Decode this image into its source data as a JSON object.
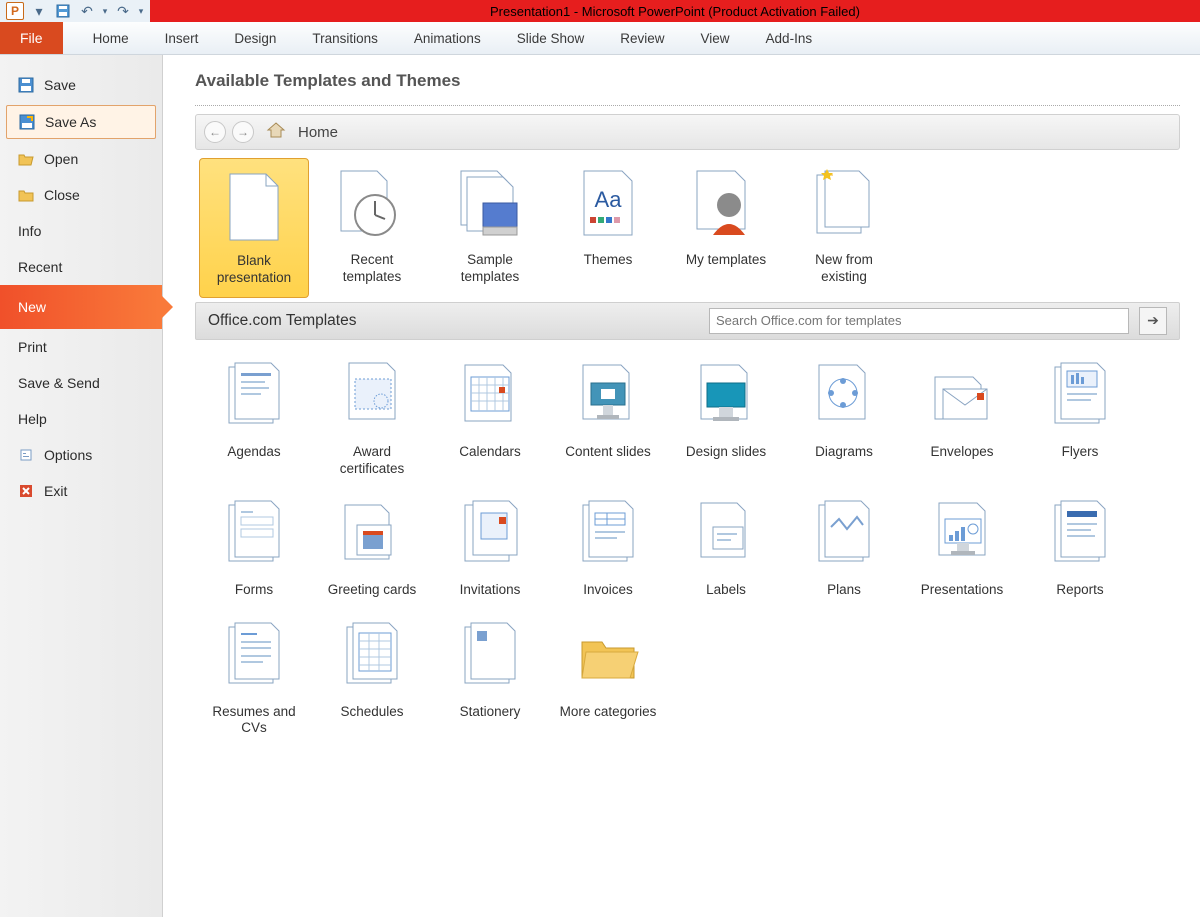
{
  "titlebar": {
    "title": "Presentation1  -  Microsoft PowerPoint (Product Activation Failed)",
    "app_letter": "P"
  },
  "ribbon": {
    "tabs": [
      "File",
      "Home",
      "Insert",
      "Design",
      "Transitions",
      "Animations",
      "Slide Show",
      "Review",
      "View",
      "Add-Ins"
    ],
    "active": "File"
  },
  "sidebar": {
    "items": [
      {
        "label": "Save",
        "icon": "save-icon"
      },
      {
        "label": "Save As",
        "icon": "save-as-icon",
        "boxed": true
      },
      {
        "label": "Open",
        "icon": "open-icon"
      },
      {
        "label": "Close",
        "icon": "close-doc-icon"
      },
      {
        "label": "Info"
      },
      {
        "label": "Recent"
      },
      {
        "label": "New",
        "active": true
      },
      {
        "label": "Print"
      },
      {
        "label": "Save & Send"
      },
      {
        "label": "Help"
      },
      {
        "label": "Options",
        "icon": "options-icon"
      },
      {
        "label": "Exit",
        "icon": "exit-icon"
      }
    ]
  },
  "content": {
    "heading": "Available Templates and Themes",
    "breadcrumb": "Home",
    "top_templates": [
      {
        "label": "Blank presentation",
        "icon": "blank",
        "selected": true
      },
      {
        "label": "Recent templates",
        "icon": "recent"
      },
      {
        "label": "Sample templates",
        "icon": "sample"
      },
      {
        "label": "Themes",
        "icon": "themes"
      },
      {
        "label": "My templates",
        "icon": "my"
      },
      {
        "label": "New from existing",
        "icon": "newfrom"
      }
    ],
    "office_section": {
      "title": "Office.com Templates",
      "search_placeholder": "Search Office.com for templates"
    },
    "office_templates": [
      {
        "label": "Agendas"
      },
      {
        "label": "Award certificates"
      },
      {
        "label": "Calendars"
      },
      {
        "label": "Content slides"
      },
      {
        "label": "Design slides"
      },
      {
        "label": "Diagrams"
      },
      {
        "label": "Envelopes"
      },
      {
        "label": "Flyers"
      },
      {
        "label": "Forms"
      },
      {
        "label": "Greeting cards"
      },
      {
        "label": "Invitations"
      },
      {
        "label": "Invoices"
      },
      {
        "label": "Labels"
      },
      {
        "label": "Plans"
      },
      {
        "label": "Presentations"
      },
      {
        "label": "Reports"
      },
      {
        "label": "Resumes and CVs"
      },
      {
        "label": "Schedules"
      },
      {
        "label": "Stationery"
      },
      {
        "label": "More categories"
      }
    ]
  }
}
